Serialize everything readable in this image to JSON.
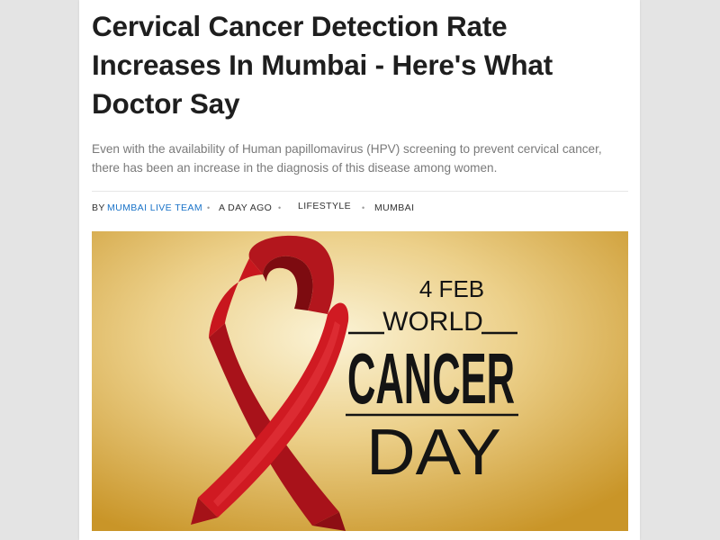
{
  "article": {
    "headline": "Cervical Cancer Detection Rate Increases In Mumbai - Here's What Doctor Say",
    "summary": "Even with the availability of Human papillomavirus (HPV) screening to prevent cervical cancer, there has been an increase in the diagnosis of this disease among women.",
    "meta": {
      "by_label": "BY",
      "author": "MUMBAI LIVE TEAM",
      "time": "A DAY AGO",
      "category": "LIFESTYLE",
      "location": "MUMBAI",
      "separator": "•"
    },
    "hero_image": {
      "date": "4 FEB",
      "line1": "WORLD",
      "line2": "CANCER",
      "line3": "DAY",
      "ribbon_color": "#c8151c",
      "background_color": "#d9b24a"
    }
  },
  "colors": {
    "headline": "#1e1e1e",
    "summary": "#7a7a7a",
    "author_link": "#1a73c8",
    "page_background": "#e4e4e4"
  }
}
